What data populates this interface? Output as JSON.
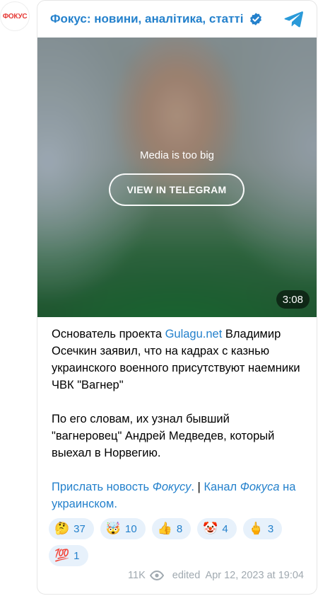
{
  "avatar": {
    "text": "ФОКУС"
  },
  "header": {
    "channel_name": "Фокус: новини, аналітика, статті"
  },
  "media": {
    "message": "Media is too big",
    "button_label": "VIEW IN TELEGRAM",
    "duration": "3:08"
  },
  "post": {
    "p1_text_a": "Основатель проекта ",
    "p1_link": "Gulagu.net",
    "p1_text_b": " Владимир Осечкин заявил, что на кадрах с казнью украинского военного присутствуют наемники ЧВК \"Вагнер\"",
    "p2_text": "По его словам, их узнал бывший \"вагнеровец\" Андрей Медведев, который выехал в Норвегию.",
    "link1_a": "Прислать новость ",
    "link1_b": "Фокусу",
    "link1_c": ".",
    "separator": " | ",
    "link2_a": "Канал ",
    "link2_b": "Фокуса",
    "link2_c": " на украинском."
  },
  "reactions": [
    {
      "emoji": "🤔",
      "count": "37"
    },
    {
      "emoji": "🤯",
      "count": "10"
    },
    {
      "emoji": "👍",
      "count": "8"
    },
    {
      "emoji": "🤡",
      "count": "4"
    },
    {
      "emoji": "🖕",
      "count": "3"
    },
    {
      "emoji": "💯",
      "count": "1"
    }
  ],
  "footer": {
    "views": "11K",
    "edited": "edited  Apr 12, 2023 at 19:04"
  },
  "colors": {
    "accent": "#2481cc",
    "muted": "#a0a9b0",
    "brand_red": "#e53935"
  }
}
